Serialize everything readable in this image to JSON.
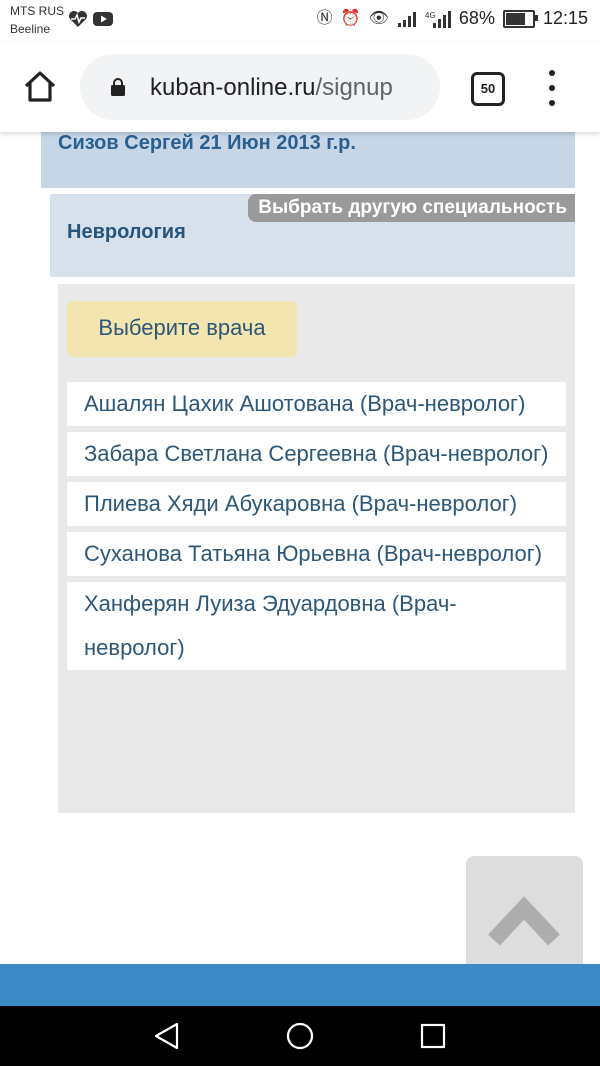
{
  "status_bar": {
    "carrier_line1": "MTS RUS",
    "carrier_line2": "Beeline",
    "left_icons": [
      "heartbeat-icon",
      "youtube-icon"
    ],
    "right_icons": [
      "nfc-icon",
      "alarm-icon",
      "eye-icon",
      "signal-icon",
      "signal-4g-icon"
    ],
    "battery_percent": "68%",
    "battery_level": 0.68,
    "time": "12:15"
  },
  "browser": {
    "url_domain": "kuban-online.ru",
    "url_path": "/signup",
    "tab_count": "50",
    "icons": [
      "home-icon",
      "lock-icon",
      "more-vert-icon"
    ]
  },
  "page": {
    "patient": "Сизов Сергей 21 Июн 2013 г.р.",
    "specialty": "Неврология",
    "change_specialty": "Выбрать другую специальность",
    "choose_doctor": "Выберите врача",
    "doctors": [
      "Ашалян Цахик Ашотована (Врач-невролог)",
      "Забара Светлана Сергеевна (Врач-невролог)",
      "Плиева Хяди Абукаровна (Врач-невролог)",
      "Суханова Татьяна Юрьевна (Врач-невролог)",
      "Ханферян Луиза Эдуардовна (Врач-невролог)"
    ],
    "scroll_top_icon": "chevron-up-icon"
  },
  "colors": {
    "accent_blue": "#3c8ac6",
    "patient_bg": "#c6d6e7",
    "label_yellow": "#f3e5b0",
    "text_blue": "#2d5778"
  },
  "nav_bar": {
    "icons": [
      "back-icon",
      "home-circle-icon",
      "recents-icon"
    ]
  }
}
